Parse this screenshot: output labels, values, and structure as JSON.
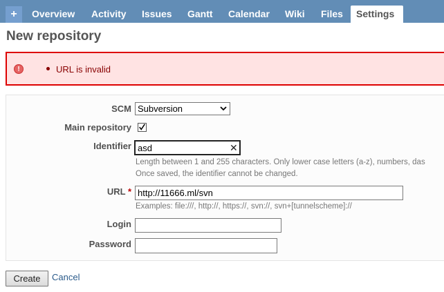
{
  "nav": {
    "plus_label": "+",
    "tabs": [
      {
        "label": "Overview"
      },
      {
        "label": "Activity"
      },
      {
        "label": "Issues"
      },
      {
        "label": "Gantt"
      },
      {
        "label": "Calendar"
      },
      {
        "label": "Wiki"
      },
      {
        "label": "Files"
      },
      {
        "label": "Settings",
        "active": true
      }
    ]
  },
  "page": {
    "title": "New repository"
  },
  "errors": {
    "items": [
      "URL is invalid"
    ],
    "icon": "error-icon"
  },
  "form": {
    "scm": {
      "label": "SCM",
      "value": "Subversion"
    },
    "main_repository": {
      "label": "Main repository",
      "checked": true
    },
    "identifier": {
      "label": "Identifier",
      "value": "asd",
      "hint_1": "Length between 1 and 255 characters. Only lower case letters (a-z), numbers, das",
      "hint_2": "Once saved, the identifier cannot be changed."
    },
    "url": {
      "label": "URL",
      "required_mark": "*",
      "value": "http://11666.ml/svn",
      "hint": "Examples: file:///, http://, https://, svn://, svn+[tunnelscheme]://"
    },
    "login": {
      "label": "Login",
      "value": ""
    },
    "password": {
      "label": "Password",
      "value": ""
    }
  },
  "actions": {
    "create_label": "Create",
    "cancel_label": "Cancel"
  },
  "colors": {
    "tabbar": "#628db6",
    "error_border": "#dd0000",
    "error_bg": "#ffe3e3",
    "error_text": "#880000"
  }
}
